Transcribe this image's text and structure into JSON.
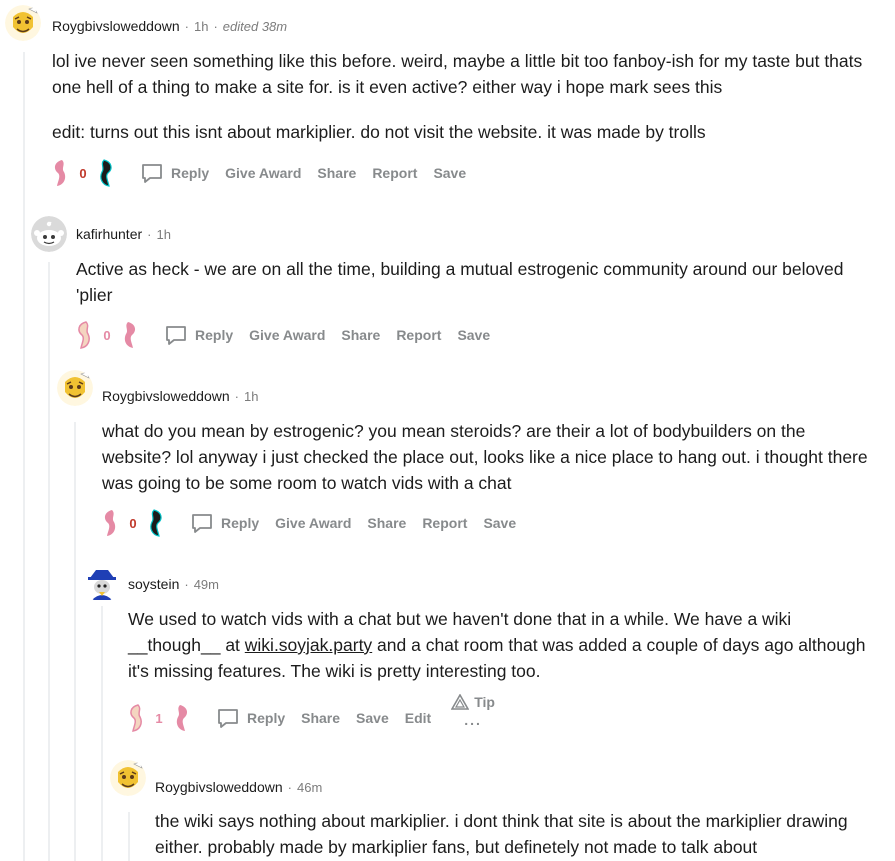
{
  "comments": [
    {
      "author": "Roygbivsloweddown",
      "time": "1h",
      "edited": "edited 38m",
      "paragraphs": [
        "lol ive never seen something like this before. weird, maybe a little bit too fanboy-ish for my taste but thats one hell of a thing to make a site for. is it even active? either way i hope mark sees this",
        "edit: turns out this isnt about markiplier. do not visit the website. it was made by trolls"
      ],
      "score": "0",
      "actions": [
        "Reply",
        "Give Award",
        "Share",
        "Report",
        "Save"
      ]
    },
    {
      "author": "kafirhunter",
      "time": "1h",
      "paragraphs": [
        "Active as heck - we are on all the time, building a mutual estrogenic community around our beloved 'plier"
      ],
      "score": "0",
      "actions": [
        "Reply",
        "Give Award",
        "Share",
        "Report",
        "Save"
      ]
    },
    {
      "author": "Roygbivsloweddown",
      "time": "1h",
      "paragraphs": [
        "what do you mean by estrogenic? you mean steroids? are their a lot of bodybuilders on the website? lol anyway i just checked the place out, looks like a nice place to hang out. i thought there was going to be some room to watch vids with a chat"
      ],
      "score": "0",
      "actions": [
        "Reply",
        "Give Award",
        "Share",
        "Report",
        "Save"
      ]
    },
    {
      "author": "soystein",
      "time": "49m",
      "text_before_link": "We used to watch vids with a chat but we haven't done that in a while. We have a wiki __though__ at ",
      "link": "wiki.soyjak.party",
      "text_after_link": " and a chat room that was added a couple of days ago although it's missing features. The wiki is pretty interesting too.",
      "score": "1",
      "actions": [
        "Reply",
        "Share",
        "Save",
        "Edit"
      ],
      "tip": "Tip",
      "more": "..."
    },
    {
      "author": "Roygbivsloweddown",
      "time": "46m",
      "paragraphs": [
        "the wiki says nothing about markiplier. i dont think that site is about the markiplier drawing either. probably made by markiplier fans, but definetely not made to talk about"
      ]
    }
  ],
  "separator": "·",
  "colors": {
    "vote_pink": "#e58aa5",
    "vote_pale": "#f4d5c0",
    "vote_dark": "#222222",
    "score_red": "#c0392b",
    "action_gray": "#878a8c",
    "thread_line": "#edeff1"
  },
  "icons": {
    "upvote": "pink-bean-upvote-icon",
    "downvote": "pink-bean-downvote-icon",
    "reply": "speech-bubble-icon",
    "tip": "triangle-logo-icon",
    "avatar_default": "reddit-snoo-avatar-icon"
  }
}
